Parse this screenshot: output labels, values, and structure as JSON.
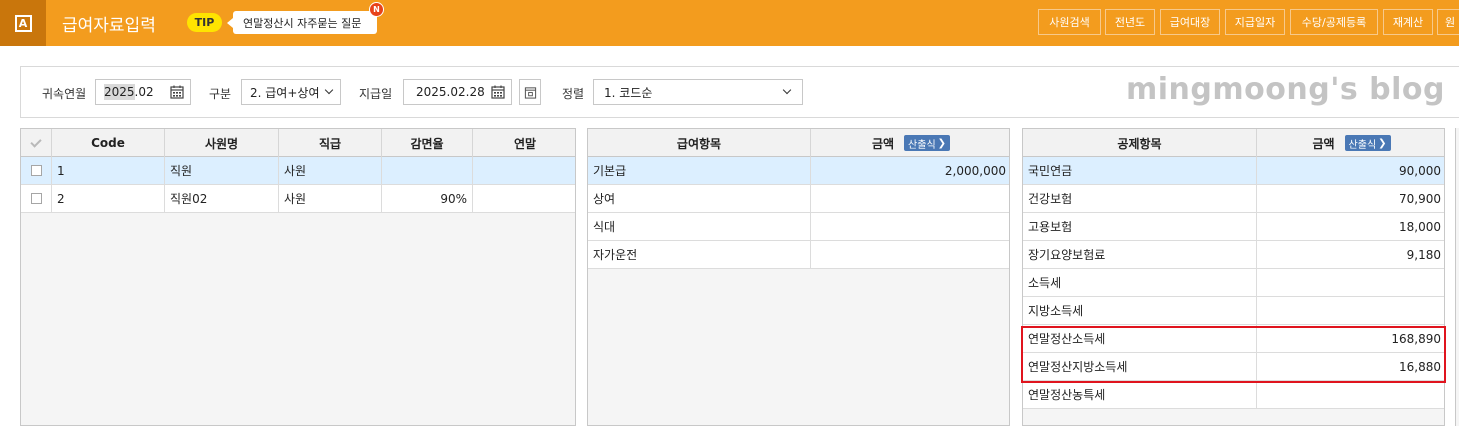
{
  "app": {
    "title": "급여자료입력",
    "icon_letter": "A",
    "tip_label": "TIP",
    "tip_text": "연말정산시 자주묻는 질문",
    "new_badge": "N"
  },
  "toolbar": {
    "buttons": [
      "사원검색",
      "전년도",
      "급여대장",
      "지급일자",
      "수당/공제등록",
      "재계산",
      "원"
    ]
  },
  "filters": {
    "period_label": "귀속연월",
    "period_value_year": "2025",
    "period_value_month": ".02",
    "type_label": "구분",
    "type_value": "2. 급여+상여",
    "paydate_label": "지급일",
    "paydate_value": "2025.02.28",
    "sort_label": "정렬",
    "sort_value": "1. 코드순"
  },
  "watermark": "mingmoong's blog",
  "employees": {
    "headers": [
      "Code",
      "사원명",
      "직급",
      "감면율",
      "연말"
    ],
    "rows": [
      {
        "code": "1",
        "name": "직원",
        "rank": "사원",
        "rate": "",
        "year_end": ""
      },
      {
        "code": "2",
        "name": "직원02",
        "rank": "사원",
        "rate": "90%",
        "year_end": ""
      }
    ]
  },
  "pay_items": {
    "headers": [
      "급여항목",
      "금액"
    ],
    "calc_label": "산출식",
    "rows": [
      {
        "item": "기본급",
        "amount": "2,000,000"
      },
      {
        "item": "상여",
        "amount": ""
      },
      {
        "item": "식대",
        "amount": ""
      },
      {
        "item": "자가운전",
        "amount": ""
      }
    ]
  },
  "deduction_items": {
    "headers": [
      "공제항목",
      "금액"
    ],
    "calc_label": "산출식",
    "rows": [
      {
        "item": "국민연금",
        "amount": "90,000"
      },
      {
        "item": "건강보험",
        "amount": "70,900"
      },
      {
        "item": "고용보험",
        "amount": "18,000"
      },
      {
        "item": "장기요양보험료",
        "amount": "9,180"
      },
      {
        "item": "소득세",
        "amount": ""
      },
      {
        "item": "지방소득세",
        "amount": ""
      },
      {
        "item": "연말정산소득세",
        "amount": "168,890"
      },
      {
        "item": "연말정산지방소득세",
        "amount": "16,880"
      },
      {
        "item": "연말정산농특세",
        "amount": ""
      }
    ]
  },
  "colors": {
    "topbar": "#f39c1e",
    "selected_row": "#dcefff",
    "highlight_border": "#e0141e",
    "calc_button": "#4a78b5"
  }
}
